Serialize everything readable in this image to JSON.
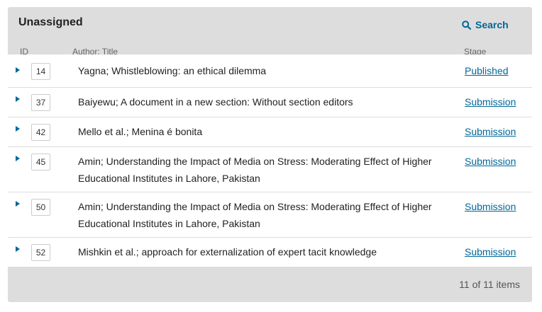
{
  "panel": {
    "title": "Unassigned",
    "search_label": "Search",
    "columns": {
      "id": "ID",
      "title": "Author; Title",
      "stage": "Stage"
    }
  },
  "rows": [
    {
      "id": "14",
      "title": "Yagna; Whistleblowing: an ethical dilemma",
      "stage": "Published"
    },
    {
      "id": "37",
      "title": "Baiyewu; A document in a new section: Without section editors",
      "stage": "Submission"
    },
    {
      "id": "42",
      "title": "Mello et al.; Menina é bonita",
      "stage": "Submission"
    },
    {
      "id": "45",
      "title": "Amin; Understanding the Impact of Media on Stress: Moderating Effect of Higher Educational Institutes in Lahore, Pakistan",
      "stage": "Submission"
    },
    {
      "id": "50",
      "title": "Amin; Understanding the Impact of Media on Stress: Moderating Effect of Higher Educational Institutes in Lahore, Pakistan",
      "stage": "Submission"
    },
    {
      "id": "52",
      "title": "Mishkin et al.; approach for externalization of expert tacit knowledge",
      "stage": "Submission"
    }
  ],
  "footer": {
    "count": "11 of 11 items"
  },
  "colors": {
    "accent": "#006798",
    "panel_bg": "#dddddd"
  }
}
